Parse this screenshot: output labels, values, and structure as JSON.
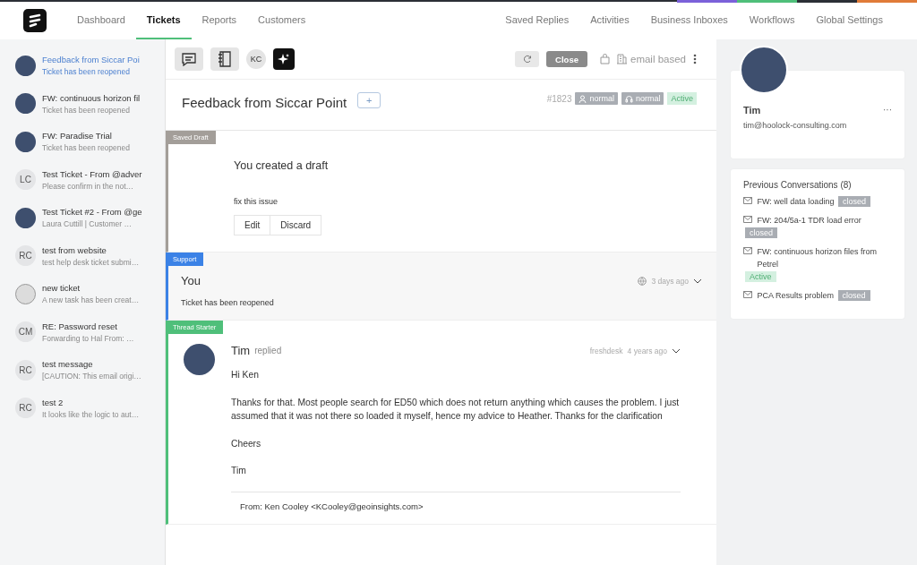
{
  "nav": {
    "tabs": [
      {
        "label": "Dashboard",
        "selected": false
      },
      {
        "label": "Tickets",
        "selected": true
      },
      {
        "label": "Reports",
        "selected": false
      },
      {
        "label": "Customers",
        "selected": false
      }
    ],
    "right_links": [
      "Saved Replies",
      "Activities",
      "Business Inboxes",
      "Workflows",
      "Global Settings"
    ]
  },
  "tickets": [
    {
      "title": "Feedback from Siccar Poi",
      "preview": "Ticket has been reopened",
      "avatar": {
        "kind": "photo"
      },
      "selected": true
    },
    {
      "title": "FW: continuous horizon fil",
      "preview": "Ticket has been reopened",
      "avatar": {
        "kind": "photo"
      },
      "selected": false
    },
    {
      "title": "FW: Paradise Trial",
      "preview": "Ticket has been reopened",
      "avatar": {
        "kind": "photo"
      },
      "selected": false
    },
    {
      "title": "Test Ticket - From @adver",
      "preview": "Please confirm in the not…",
      "avatar": {
        "kind": "initials",
        "text": "LC"
      },
      "selected": false
    },
    {
      "title": "Test Ticket #2 - From @ge",
      "preview": "Laura Cuttill | Customer …",
      "avatar": {
        "kind": "photo"
      },
      "selected": false
    },
    {
      "title": "test from website",
      "preview": "test help desk ticket submi…",
      "avatar": {
        "kind": "initials",
        "text": "RC"
      },
      "selected": false
    },
    {
      "title": "new ticket",
      "preview": "A new task has been creat…",
      "avatar": {
        "kind": "picture"
      },
      "selected": false
    },
    {
      "title": "RE: Password reset",
      "preview": "Forwarding to Hal   From: …",
      "avatar": {
        "kind": "initials",
        "text": "CM"
      },
      "selected": false
    },
    {
      "title": "test message",
      "preview": "[CAUTION: This email origi…",
      "avatar": {
        "kind": "initials",
        "text": "RC"
      },
      "selected": false
    },
    {
      "title": "test 2",
      "preview": "It looks like the logic to aut…",
      "avatar": {
        "kind": "initials",
        "text": "RC"
      },
      "selected": false
    }
  ],
  "toolbar": {
    "agent_initials": "KC",
    "close_button": "Close",
    "channel": "email based"
  },
  "ticket": {
    "subject": "Feedback from Siccar Point",
    "add_button": "+",
    "number": "#1823",
    "tags": [
      {
        "text": "normal",
        "kind": "priority"
      },
      {
        "text": "normal",
        "kind": "agent"
      }
    ],
    "status": {
      "text": "Active",
      "color": "#d4f0e0"
    }
  },
  "thread": [
    {
      "kind": "draft",
      "label": "Saved Draft",
      "color": "#a39e99",
      "heading": "You created a draft",
      "body": [
        "fix this issue"
      ],
      "actions": [
        "Edit",
        "Discard"
      ]
    },
    {
      "kind": "note",
      "label": "Support",
      "color": "#3b82e6",
      "author": "You",
      "time": "3 days ago",
      "body": [
        "Ticket has been reopened"
      ]
    },
    {
      "kind": "reply",
      "label": "Thread Starter",
      "color": "#4fbf7a",
      "author": "Tim",
      "verb": "replied",
      "source": "freshdesk",
      "time": "4 years ago",
      "body": [
        "Hi Ken",
        "Thanks for that.  Most people search for ED50 which does not return anything which causes the problem.  I just assumed that it was not there so loaded it myself, hence my advice to Heather.  Thanks for the clarification",
        "Cheers",
        "Tim"
      ],
      "quote": "From: Ken Cooley <KCooley@geoinsights.com>"
    }
  ],
  "contact": {
    "name": "Tim",
    "email": "tim@hoolock-consulting.com",
    "menu": "···"
  },
  "previous": {
    "title": "Previous Conversations (8)",
    "items": [
      {
        "subject": "FW: well data loading",
        "status": "closed",
        "color": "#a9adb3"
      },
      {
        "subject": "FW: 204/5a-1 TDR load error",
        "status": "closed",
        "color": "#a9adb3"
      },
      {
        "subject": "FW: continuous horizon files from Petrel",
        "status": "Active",
        "color": "#d4f0e0"
      },
      {
        "subject": "PCA Results problem",
        "status": "closed",
        "color": "#a9adb3"
      }
    ]
  }
}
